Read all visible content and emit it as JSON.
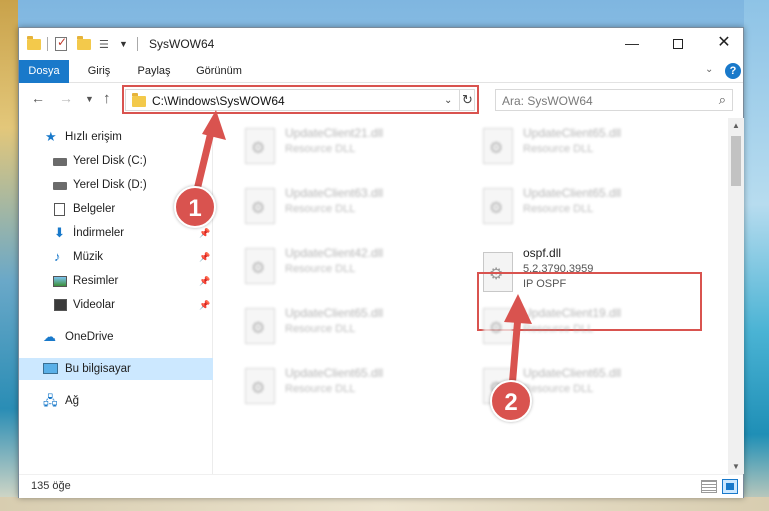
{
  "window": {
    "title": "SysWOW64",
    "minimize_glyph": "—",
    "close_glyph": "✕"
  },
  "ribbon": {
    "tabs": [
      "Dosya",
      "Giriş",
      "Paylaş",
      "Görünüm"
    ],
    "help_glyph": "?"
  },
  "nav": {
    "address_path": "C:\\Windows\\SysWOW64",
    "search_placeholder": "Ara: SysWOW64"
  },
  "sidebar": {
    "items": [
      {
        "label": "Hızlı erişim"
      },
      {
        "label": "Yerel Disk (C:)"
      },
      {
        "label": "Yerel Disk (D:)"
      },
      {
        "label": "Belgeler"
      },
      {
        "label": "İndirmeler"
      },
      {
        "label": "Müzik"
      },
      {
        "label": "Resimler"
      },
      {
        "label": "Videolar"
      },
      {
        "label": "OneDrive"
      },
      {
        "label": "Bu bilgisayar"
      },
      {
        "label": "Ağ"
      }
    ]
  },
  "files": [
    {
      "name": "UpdateClient21.dll",
      "desc": "Resource DLL"
    },
    {
      "name": "UpdateClient65.dll",
      "desc": "Resource DLL"
    },
    {
      "name": "UpdateClient63.dll",
      "desc": "Resource DLL"
    },
    {
      "name": "UpdateClient65.dll",
      "desc": "Resource DLL"
    },
    {
      "name": "UpdateClient42.dll",
      "desc": "Resource DLL"
    },
    {
      "name": "ospf.dll",
      "version": "5.2.3790.3959",
      "desc": "IP OSPF"
    },
    {
      "name": "UpdateClient65.dll",
      "desc": "Resource DLL"
    },
    {
      "name": "UpdateClient19.dll",
      "desc": "Resource DLL"
    },
    {
      "name": "UpdateClient65.dll",
      "desc": "Resource DLL"
    },
    {
      "name": "UpdateClient65.dll",
      "desc": "Resource DLL"
    }
  ],
  "status": {
    "item_count": "135 öğe"
  },
  "annotations": {
    "step1": "1",
    "step2": "2",
    "highlight_color": "#d9534f"
  },
  "colors": {
    "accent": "#1979ca",
    "selected_bg": "#cce8ff"
  }
}
